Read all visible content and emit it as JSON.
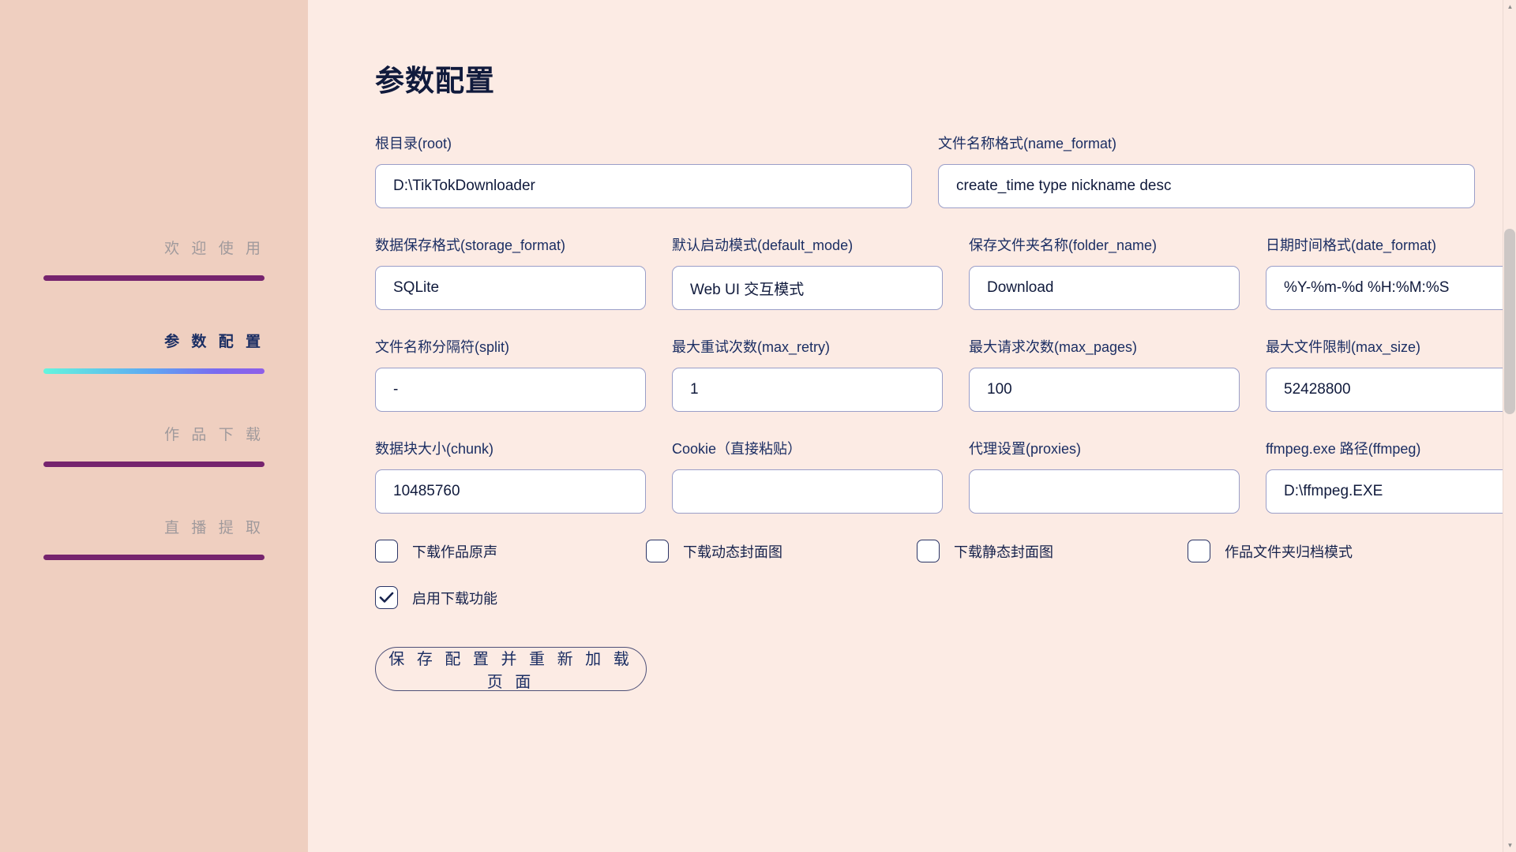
{
  "sidebar": {
    "items": [
      {
        "label": "欢 迎 使 用",
        "active": false
      },
      {
        "label": "参 数 配 置",
        "active": true
      },
      {
        "label": "作 品 下 载",
        "active": false
      },
      {
        "label": "直 播 提 取",
        "active": false
      }
    ],
    "colors": {
      "background": "#efcfc0",
      "bar_inactive": "#76246e",
      "bar_active_from": "#63f5dd",
      "bar_active_to": "#8f5fe8",
      "label_inactive": "#a09a9c",
      "label_active": "#1b2e63"
    }
  },
  "main": {
    "title": "参数配置",
    "background": "#fcebe4",
    "rows": [
      {
        "columns": 2,
        "fields": [
          {
            "label": "根目录(root)",
            "value": "D:\\TikTokDownloader",
            "name": "root"
          },
          {
            "label": "文件名称格式(name_format)",
            "value": "create_time type nickname desc",
            "name": "name-format"
          }
        ]
      },
      {
        "columns": 4,
        "fields": [
          {
            "label": "数据保存格式(storage_format)",
            "value": "SQLite",
            "name": "storage-format"
          },
          {
            "label": "默认启动模式(default_mode)",
            "value": "Web UI 交互模式",
            "name": "default-mode"
          },
          {
            "label": "保存文件夹名称(folder_name)",
            "value": "Download",
            "name": "folder-name"
          },
          {
            "label": "日期时间格式(date_format)",
            "value": "%Y-%m-%d %H:%M:%S",
            "name": "date-format"
          }
        ]
      },
      {
        "columns": 4,
        "fields": [
          {
            "label": "文件名称分隔符(split)",
            "value": "-",
            "name": "split"
          },
          {
            "label": "最大重试次数(max_retry)",
            "value": "1",
            "name": "max-retry"
          },
          {
            "label": "最大请求次数(max_pages)",
            "value": "100",
            "name": "max-pages"
          },
          {
            "label": "最大文件限制(max_size)",
            "value": "52428800",
            "name": "max-size"
          }
        ]
      },
      {
        "columns": 4,
        "fields": [
          {
            "label": "数据块大小(chunk)",
            "value": "10485760",
            "name": "chunk"
          },
          {
            "label": "Cookie（直接粘贴）",
            "value": "",
            "name": "cookie"
          },
          {
            "label": "代理设置(proxies)",
            "value": "",
            "name": "proxies"
          },
          {
            "label": "ffmpeg.exe 路径(ffmpeg)",
            "value": "D:\\ffmpeg.EXE",
            "name": "ffmpeg"
          }
        ]
      }
    ],
    "checkbox_rows": [
      [
        {
          "label": "下载作品原声",
          "checked": false,
          "name": "download-original-audio"
        },
        {
          "label": "下载动态封面图",
          "checked": false,
          "name": "download-dynamic-cover"
        },
        {
          "label": "下载静态封面图",
          "checked": false,
          "name": "download-static-cover"
        },
        {
          "label": "作品文件夹归档模式",
          "checked": false,
          "name": "folder-archive-mode"
        }
      ],
      [
        {
          "label": "启用下载功能",
          "checked": true,
          "name": "enable-download"
        }
      ]
    ],
    "save_button": "保 存 配 置 并 重 新 加 载 页 面"
  },
  "scrollbar": {
    "up_arrow": "▲",
    "down_arrow": "▼"
  }
}
